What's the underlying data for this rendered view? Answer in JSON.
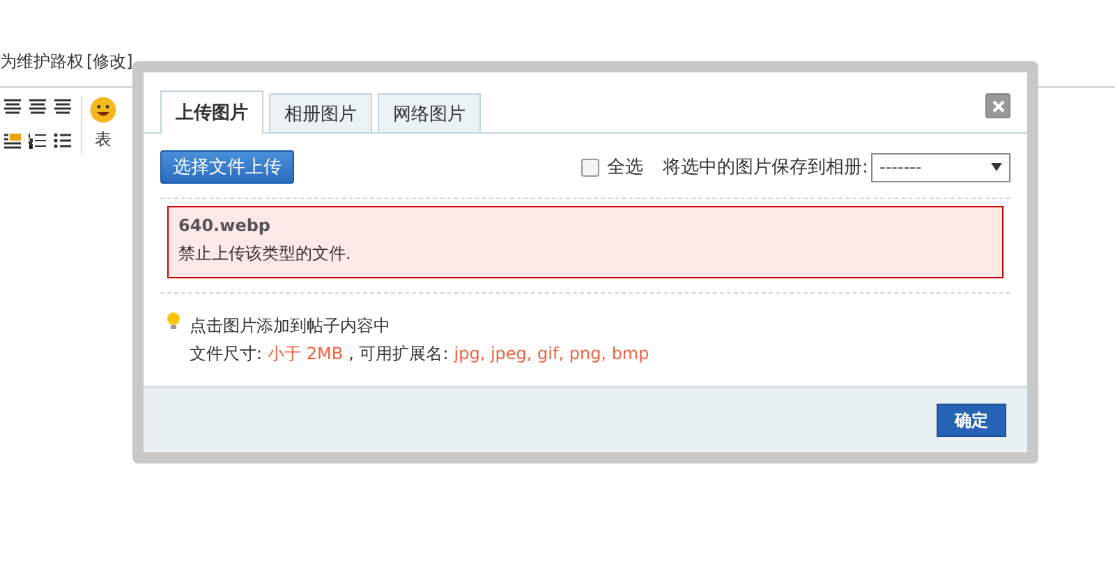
{
  "page": {
    "notice": "为维护路权",
    "edit_link": "[修改]",
    "toolbar": {
      "emoji_label": "表"
    }
  },
  "dialog": {
    "tabs": [
      {
        "label": "上传图片",
        "selected": true
      },
      {
        "label": "相册图片",
        "selected": false
      },
      {
        "label": "网络图片",
        "selected": false
      }
    ],
    "upload_button": "选择文件上传",
    "select_all": {
      "label": "全选",
      "checked": false
    },
    "save_label": "将选中的图片保存到相册:",
    "album_select": {
      "value": "-------"
    },
    "error": {
      "filename": "640.webp",
      "message": "禁止上传该类型的文件."
    },
    "tip": {
      "line1": "点击图片添加到帖子内容中",
      "size_label": "文件尺寸:",
      "size": "小于 2MB",
      "ext_label": ", 可用扩展名:",
      "extensions": "jpg, jpeg, gif, png, bmp"
    },
    "confirm": "确定"
  }
}
